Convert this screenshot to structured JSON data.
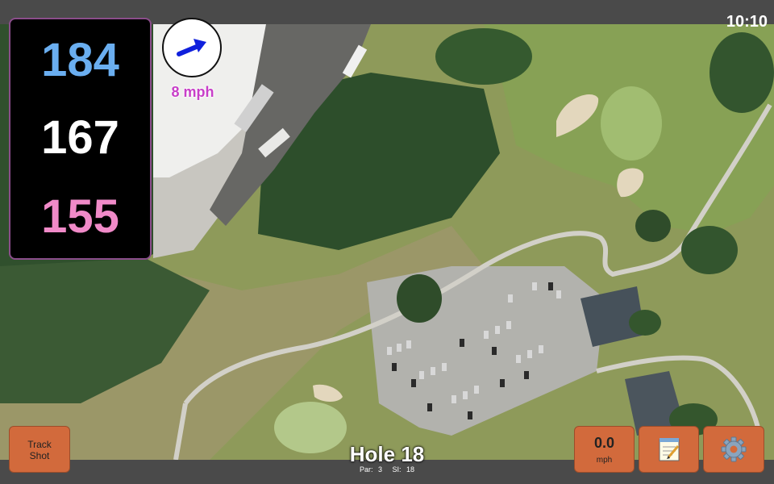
{
  "status": {
    "time": "10:10"
  },
  "distances": {
    "back": "184",
    "middle": "167",
    "front": "155"
  },
  "wind": {
    "speed_label": "8 mph",
    "icon": "arrow-right-icon"
  },
  "buttons": {
    "track_shot": "Track\nShot",
    "speed_value": "0.0",
    "speed_unit": "mph",
    "notes_icon": "notepad-icon",
    "settings_icon": "gear-icon"
  },
  "hole": {
    "title": "Hole 18",
    "par": "Par: 3",
    "si": "SI: 18"
  },
  "colors": {
    "back": "#6aaef0",
    "middle": "#ffffff",
    "front": "#f08ac8",
    "button": "#d26a3c",
    "wind_text": "#c83fc8"
  }
}
